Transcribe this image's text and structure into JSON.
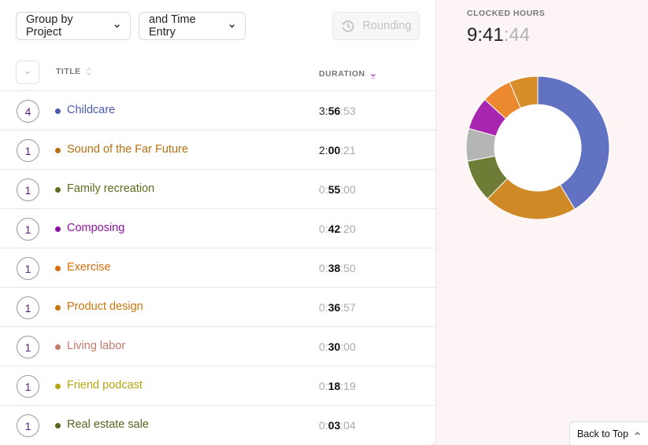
{
  "toolbar": {
    "group_label": "Group by Project",
    "entry_label": "and Time Entry",
    "rounding_label": "Rounding"
  },
  "table": {
    "columns": {
      "title": "TITLE",
      "duration": "DURATION"
    },
    "rows": [
      {
        "count": "4",
        "title": "Childcare",
        "color": "#4a5aad",
        "h": "3",
        "m": "56",
        "s": "53"
      },
      {
        "count": "1",
        "title": "Sound of the Far Future",
        "color": "#b5700f",
        "h": "2",
        "m": "00",
        "s": "21"
      },
      {
        "count": "1",
        "title": "Family recreation",
        "color": "#5c6d1e",
        "h": "0",
        "m": "55",
        "s": "00"
      },
      {
        "count": "1",
        "title": "Composing",
        "color": "#8d12a3",
        "h": "0",
        "m": "42",
        "s": "20"
      },
      {
        "count": "1",
        "title": "Exercise",
        "color": "#d96c0a",
        "h": "0",
        "m": "38",
        "s": "50"
      },
      {
        "count": "1",
        "title": "Product design",
        "color": "#c8760c",
        "h": "0",
        "m": "36",
        "s": "57"
      },
      {
        "count": "1",
        "title": "Living labor",
        "color": "#c27a6c",
        "h": "0",
        "m": "30",
        "s": "00"
      },
      {
        "count": "1",
        "title": "Friend podcast",
        "color": "#b8a512",
        "h": "0",
        "m": "18",
        "s": "19"
      },
      {
        "count": "1",
        "title": "Real estate sale",
        "color": "#56641c",
        "h": "0",
        "m": "03",
        "s": "04"
      }
    ]
  },
  "summary": {
    "label": "CLOCKED HOURS",
    "hm": "9:41",
    "sec": ":44"
  },
  "chart_data": {
    "type": "pie",
    "series": [
      {
        "value": 14213,
        "color": "#6272c2"
      },
      {
        "value": 7221,
        "color": "#cf8a27"
      },
      {
        "value": 3300,
        "color": "#6e7d35"
      },
      {
        "value": 2540,
        "color": "#b5b5b5"
      },
      {
        "value": 2540,
        "color": "#a825b0"
      },
      {
        "value": 2330,
        "color": "#ec8830"
      },
      {
        "value": 2217,
        "color": "#d68d2a"
      }
    ]
  },
  "back_to_top": "Back to Top"
}
